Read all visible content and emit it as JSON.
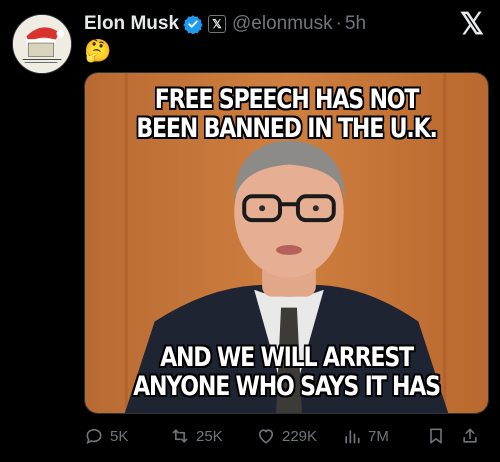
{
  "author": {
    "name": "Elon Musk",
    "handle": "@elonmusk",
    "separator": "·",
    "time": "5h",
    "affiliate_badge": "𝕏"
  },
  "top_right_logo": "𝕏",
  "tweet": {
    "text_emoji": "🤔"
  },
  "media": {
    "caption_top": "FREE SPEECH HAS NOT BEEN BANNED IN THE U.K.",
    "caption_bottom": "AND WE WILL ARREST ANYONE WHO SAYS IT HAS"
  },
  "actions": {
    "replies": "5K",
    "reposts": "25K",
    "likes": "229K",
    "views": "7M"
  },
  "colors": {
    "background": "#000000",
    "text": "#e7e9ea",
    "muted": "#71767b",
    "verified": "#1d9bf0"
  },
  "icons": [
    "verified-icon",
    "reply-icon",
    "repost-icon",
    "like-icon",
    "views-icon",
    "bookmark-icon",
    "share-icon"
  ]
}
